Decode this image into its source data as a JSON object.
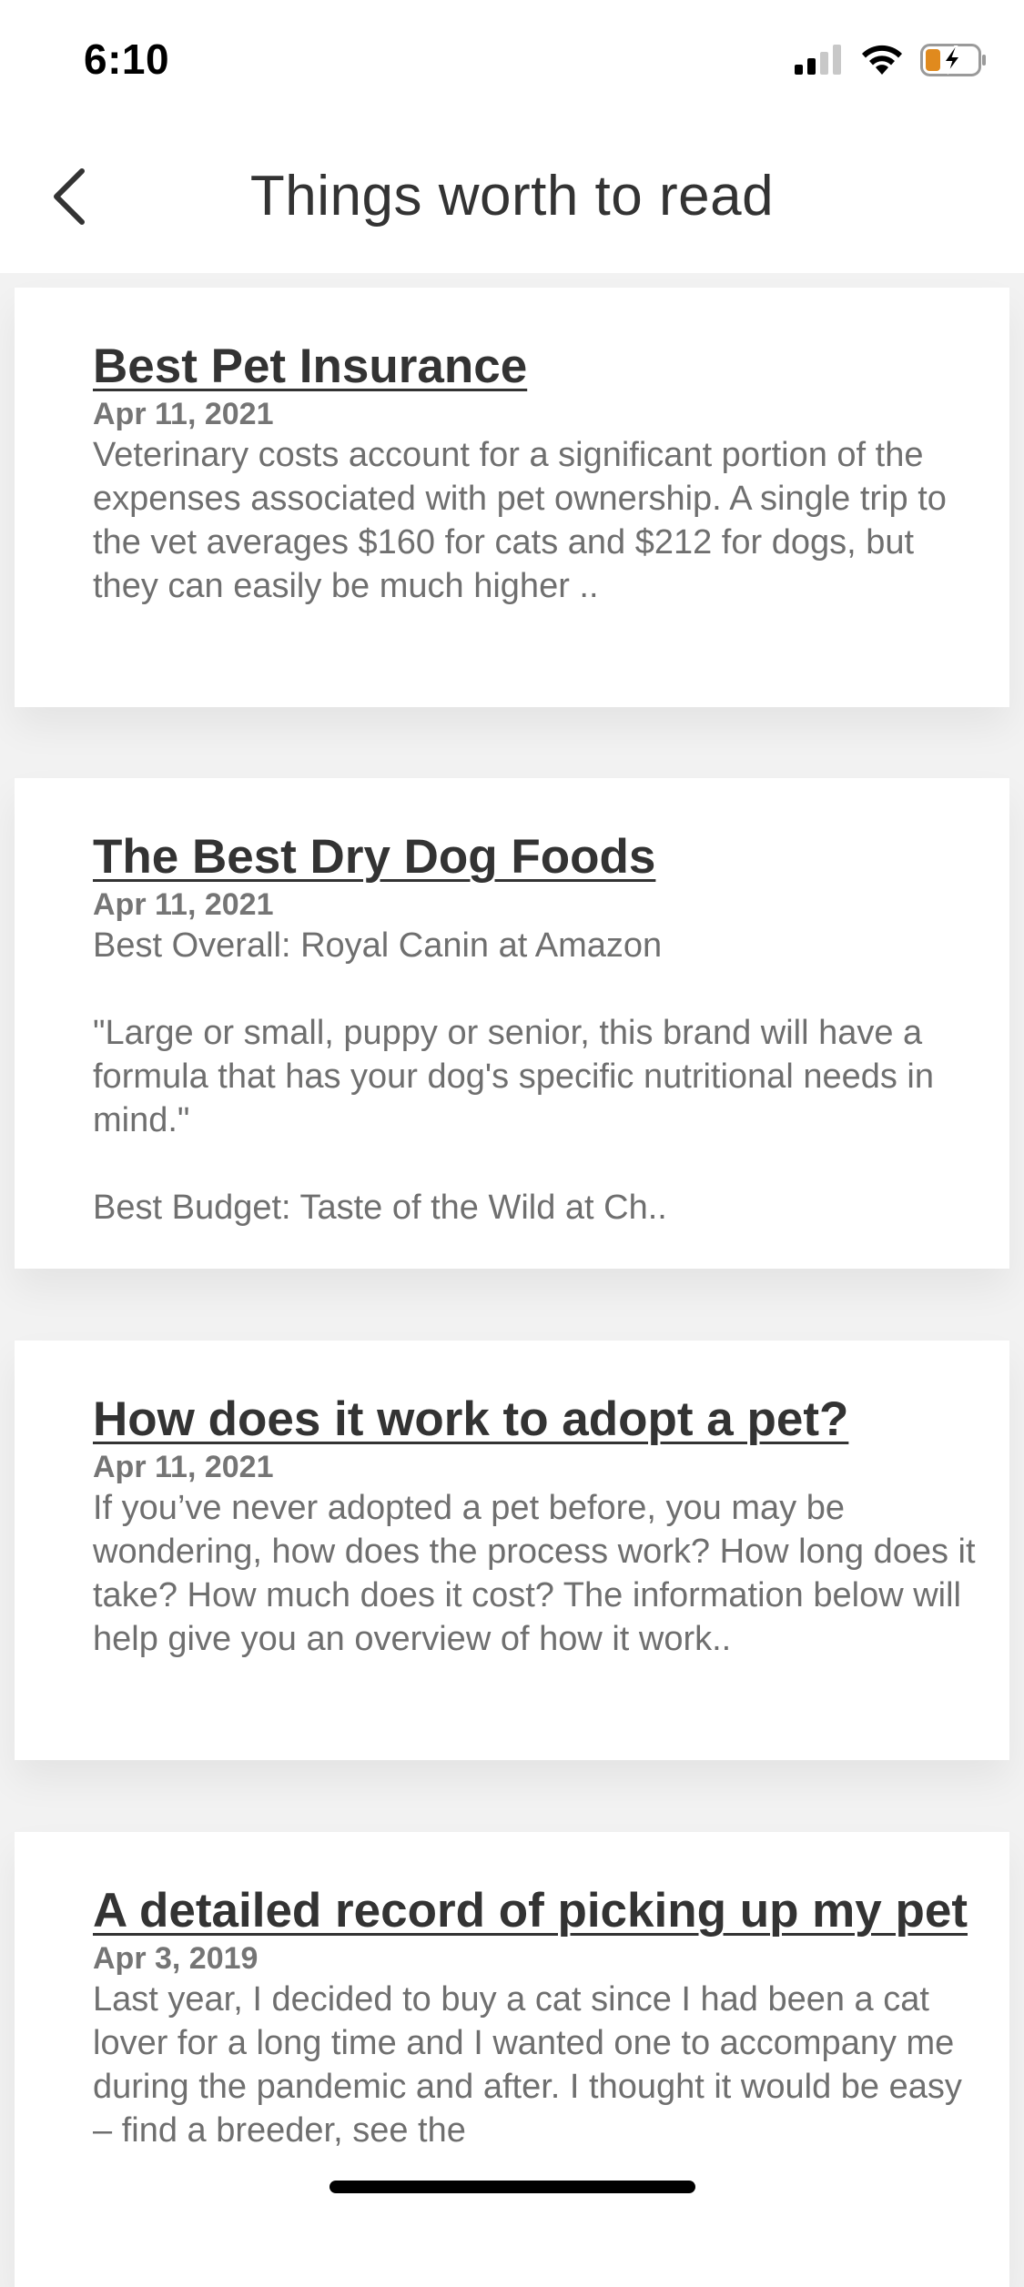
{
  "status_bar": {
    "time": "6:10",
    "icons": [
      "cellular-signal-icon",
      "wifi-icon",
      "battery-charging-icon"
    ],
    "battery_color": "#e08a1e"
  },
  "nav": {
    "back_icon": "chevron-left-icon",
    "title": "Things worth to read"
  },
  "articles": [
    {
      "title": "Best Pet Insurance",
      "date": "Apr 11, 2021",
      "excerpt": "Veterinary costs account for a significant portion of the expenses associated with pet ownership. A single trip to the vet averages $160 for cats and $212 for dogs, but they can easily be much higher .."
    },
    {
      "title": "The Best Dry Dog Foods",
      "date": "Apr 11, 2021",
      "excerpt": "Best Overall: Royal Canin at Amazon\n\n\"Large or small, puppy or senior, this brand will have a formula that has your dog's specific nutritional needs in mind.\"\n\nBest Budget: Taste of the Wild at Ch.."
    },
    {
      "title": "How does it work to adopt a pet?",
      "date": "Apr 11, 2021",
      "excerpt": "If you’ve never adopted a pet before, you may be wondering, how does the process work? How long does it take? How much does it cost? The information below will help give you an overview of how it work.."
    },
    {
      "title": "A detailed record of picking up my pet",
      "date": "Apr 3, 2019",
      "excerpt": "Last year, I decided to buy a cat since I had been a cat lover for a long time and I wanted one to accompany me during the pandemic and after. I thought it would be easy – find a breeder, see the"
    }
  ]
}
